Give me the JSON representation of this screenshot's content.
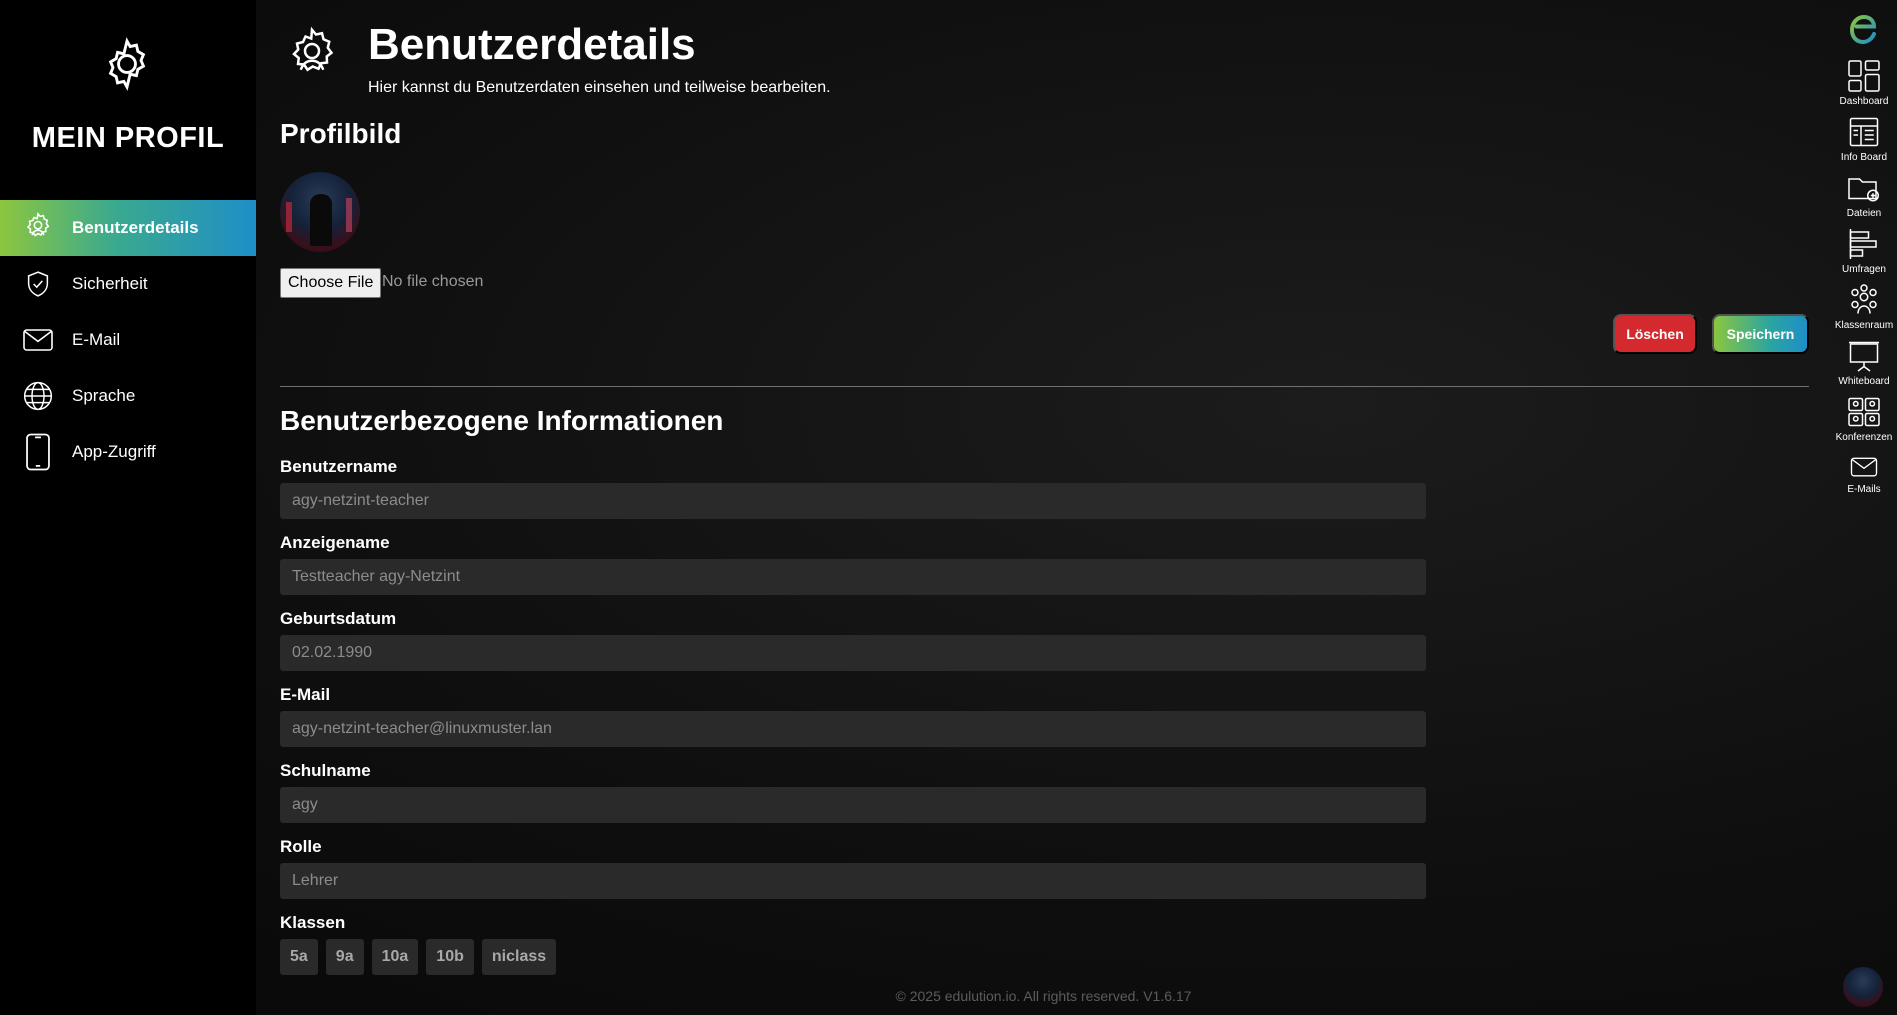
{
  "sidebar": {
    "title": "MEIN PROFIL",
    "items": [
      {
        "label": "Benutzerdetails",
        "icon": "user-gear-icon",
        "active": true
      },
      {
        "label": "Sicherheit",
        "icon": "shield-check-icon"
      },
      {
        "label": "E-Mail",
        "icon": "mail-icon"
      },
      {
        "label": "Sprache",
        "icon": "globe-icon"
      },
      {
        "label": "App-Zugriff",
        "icon": "tablet-icon"
      }
    ]
  },
  "header": {
    "title": "Benutzerdetails",
    "subtitle": "Hier kannst du Benutzerdaten einsehen und teilweise bearbeiten."
  },
  "profile_picture": {
    "heading": "Profilbild",
    "file_button": "Choose File",
    "file_status": "No file chosen",
    "delete_label": "Löschen",
    "save_label": "Speichern"
  },
  "info": {
    "heading": "Benutzerbezogene Informationen",
    "fields": [
      {
        "label": "Benutzername",
        "value": "agy-netzint-teacher"
      },
      {
        "label": "Anzeigename",
        "value": "Testteacher agy-Netzint"
      },
      {
        "label": "Geburtsdatum",
        "value": "02.02.1990"
      },
      {
        "label": "E-Mail",
        "value": "agy-netzint-teacher@linuxmuster.lan"
      },
      {
        "label": "Schulname",
        "value": "agy"
      },
      {
        "label": "Rolle",
        "value": "Lehrer"
      }
    ],
    "classes_label": "Klassen",
    "classes": [
      "5a",
      "9a",
      "10a",
      "10b",
      "niclass"
    ]
  },
  "footer": "© 2025 edulution.io. All rights reserved. V1.6.17",
  "rail": {
    "items": [
      {
        "label": "Dashboard",
        "icon": "dashboard-icon"
      },
      {
        "label": "Info Board",
        "icon": "info-board-icon"
      },
      {
        "label": "Dateien",
        "icon": "files-icon"
      },
      {
        "label": "Umfragen",
        "icon": "surveys-icon"
      },
      {
        "label": "Klassenraum",
        "icon": "classroom-icon"
      },
      {
        "label": "Whiteboard",
        "icon": "whiteboard-icon"
      },
      {
        "label": "Konferenzen",
        "icon": "conferences-icon"
      },
      {
        "label": "E-Mails",
        "icon": "mail-icon"
      }
    ]
  },
  "colors": {
    "accent_green": "#8cc63f",
    "accent_blue": "#1e8fc7",
    "delete_red": "#d42a2f",
    "field_bg": "#2a2a2a"
  }
}
